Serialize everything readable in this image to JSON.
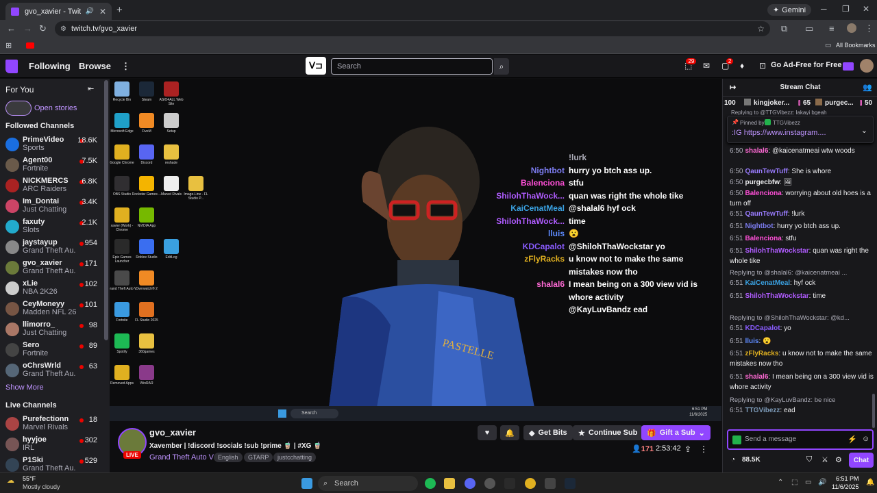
{
  "browser": {
    "tab_title": "gvo_xavier - Twitch",
    "new_tab": "+",
    "gemini_label": "Gemini",
    "url": "twitch.tv/gvo_xavier",
    "bookmarks_label": "All Bookmarks"
  },
  "twitch_nav": {
    "following": "Following",
    "browse": "Browse",
    "search_placeholder": "Search",
    "notif_count_1": "29",
    "notif_count_2": "2",
    "ad_free": "Go Ad-Free for Free"
  },
  "sidebar": {
    "for_you": "For You",
    "open_stories": "Open stories",
    "followed_header": "Followed Channels",
    "followed": [
      {
        "name": "PrimeVideo",
        "game": "Sports",
        "viewers": "18.6K",
        "color": "#1a6ee0"
      },
      {
        "name": "Agent00",
        "game": "Fortnite",
        "viewers": "7.5K",
        "color": "#6a5a4a"
      },
      {
        "name": "NICKMERCS",
        "game": "ARC Raiders",
        "viewers": "6.8K",
        "color": "#aa2222"
      },
      {
        "name": "Im_Dontai",
        "game": "Just Chatting",
        "viewers": "3.4K",
        "color": "#cc4466"
      },
      {
        "name": "faxuty",
        "game": "Slots",
        "viewers": "2.1K",
        "color": "#22aacc"
      },
      {
        "name": "jaystayup",
        "game": "Grand Theft Au...",
        "viewers": "954",
        "color": "#888888"
      },
      {
        "name": "gvo_xavier",
        "game": "Grand Theft Au...",
        "viewers": "171",
        "color": "#6b7a3a"
      },
      {
        "name": "xLie",
        "game": "NBA 2K26",
        "viewers": "102",
        "color": "#cccccc"
      },
      {
        "name": "CeyMoneyy",
        "game": "Madden NFL 26",
        "viewers": "101",
        "color": "#775544"
      },
      {
        "name": "llimorro_",
        "game": "Just Chatting",
        "viewers": "98",
        "color": "#aa7766"
      },
      {
        "name": "Sero",
        "game": "Fortnite",
        "viewers": "89",
        "color": "#444444"
      },
      {
        "name": "oChrsWrld",
        "game": "Grand Theft Au...",
        "viewers": "63",
        "color": "#556677"
      }
    ],
    "show_more": "Show More",
    "live_header": "Live Channels",
    "live": [
      {
        "name": "Purefectionn",
        "game": "Marvel Rivals",
        "viewers": "18",
        "color": "#aa4444"
      },
      {
        "name": "hyyjoe",
        "game": "IRL",
        "viewers": "302",
        "color": "#775555"
      },
      {
        "name": "P1Ski",
        "game": "Grand Theft Au...",
        "viewers": "529",
        "color": "#334455"
      }
    ]
  },
  "desktop_icons": [
    {
      "label": "Recycle Bin",
      "color": "#7fb0e0"
    },
    {
      "label": "Steam",
      "color": "#1b2838"
    },
    {
      "label": "ASIO4ALL Web Site",
      "color": "#aa2222"
    },
    {
      "label": "Microsoft Edge",
      "color": "#1fa0c8"
    },
    {
      "label": "FiveM",
      "color": "#f08a24"
    },
    {
      "label": "Setup",
      "color": "#cccccc"
    },
    {
      "label": "Google Chrome",
      "color": "#e0b020"
    },
    {
      "label": "Discord",
      "color": "#5865f2"
    },
    {
      "label": "reshade",
      "color": "#e8c040"
    },
    {
      "label": "OBS Studio",
      "color": "#302e31"
    },
    {
      "label": "Rockstar Games ...",
      "color": "#f4b400"
    },
    {
      "label": "Marvel Rivals",
      "color": "#eeeeee"
    },
    {
      "label": "Image-Line - FL Studio P...",
      "color": "#e8c040"
    },
    {
      "label": "xavier (Work) - Chrome",
      "color": "#e0b020"
    },
    {
      "label": "NVIDIA App",
      "color": "#76b900"
    },
    {
      "label": "Epic Games Launcher",
      "color": "#2a2a2a"
    },
    {
      "label": "Roblox Studio",
      "color": "#3a6ef0"
    },
    {
      "label": "EditLog",
      "color": "#3aa0e0"
    },
    {
      "label": "Grand Theft Auto V",
      "color": "#4a4a4a"
    },
    {
      "label": "Overwatch® 2",
      "color": "#f08a24"
    },
    {
      "label": "Fortnite",
      "color": "#3a9ae0"
    },
    {
      "label": "FL Studio 2025",
      "color": "#e07020"
    },
    {
      "label": "Spotify",
      "color": "#1db954"
    },
    {
      "label": "360games",
      "color": "#e8c040"
    },
    {
      "label": "Removed Apps",
      "color": "#e0b020"
    },
    {
      "label": "WinRAR",
      "color": "#8a3a8a"
    }
  ],
  "overlay_chat": [
    {
      "user": "",
      "msg": "!lurk",
      "color": "#adadb8"
    },
    {
      "user": "Nightbot",
      "msg": "hurry yo btch ass up.",
      "color": "#7c7cf0"
    },
    {
      "user": "Balenciona",
      "msg": "stfu",
      "color": "#ff4fd8"
    },
    {
      "user": "ShilohThaWock...",
      "msg": "quan was right the whole tike",
      "color": "#b05cff"
    },
    {
      "user": "KaiCenatMeal",
      "msg": "@shalal6 hyf ock",
      "color": "#3aa0e0"
    },
    {
      "user": "ShilohThaWock...",
      "msg": "time",
      "color": "#b05cff"
    },
    {
      "user": "lluis",
      "msg": "😮",
      "color": "#5e8bff"
    },
    {
      "user": "KDCapalot",
      "msg": "@ShilohThaWockstar yo",
      "color": "#8a5cff"
    },
    {
      "user": "zFlyRacks",
      "msg": "u know not to make the same",
      "color": "#e0b020"
    },
    {
      "user": "",
      "msg": "mistakes now tho",
      "color": "#ffffff"
    },
    {
      "user": "shalal6",
      "msg": "I mean being on a 300 view vid is",
      "color": "#ff6ad5"
    },
    {
      "user": "",
      "msg": "whore activity",
      "color": "#ffffff"
    },
    {
      "user": "",
      "msg": "@KayLuvBandz ead",
      "color": "#ffffff"
    }
  ],
  "vtaskbar_search": "Search",
  "vtaskbar_time": "6:51 PM",
  "vtaskbar_date": "11/6/2025",
  "stream": {
    "name": "gvo_xavier",
    "live": "LIVE",
    "title": "Xavember | !discord !socials !sub !prime 🧋 | #XG 🧋",
    "game": "Grand Theft Auto V",
    "tags": [
      "English",
      "GTARP",
      "justcchatting"
    ],
    "get_bits": "Get Bits",
    "continue_sub": "Continue Sub",
    "gift_sub": "Gift a Sub",
    "viewers": "171",
    "uptime": "2:53:42"
  },
  "chat": {
    "header": "Stream Chat",
    "leader_count": "100",
    "leader1": "kingjoker...",
    "leader1_val": "65",
    "leader2": "purgec...",
    "leader2_val": "50",
    "cut_reply": "Replying to @TTGVibezz: lakayi bgeah",
    "pinned_by": "Pinned by",
    "pinned_user": "TTGVibezz",
    "pinned_text": ":IG https://www.instagram....",
    "messages": [
      {
        "ts": "6:50",
        "user": "shalal6",
        "msg": ": @kaicenatmeai wtw woods",
        "color": "#ff6ad5",
        "reply": ""
      },
      {
        "ts": "6:50",
        "user": "QaunTewTuff",
        "msg": ": She is whore",
        "color": "#9a7cff",
        "reply": ""
      },
      {
        "ts": "6:50",
        "user": "purgecbfw",
        "msg": ": 🖼",
        "color": "#efeff1",
        "reply": ""
      },
      {
        "ts": "6:50",
        "user": "Balenciona",
        "msg": ": worrying about old hoes is a turn off",
        "color": "#ff4fd8",
        "reply": ""
      },
      {
        "ts": "6:51",
        "user": "QaunTewTuff",
        "msg": ": !lurk",
        "color": "#9a7cff",
        "reply": ""
      },
      {
        "ts": "6:51",
        "user": "Nightbot",
        "msg": ": hurry yo btch ass up.",
        "color": "#7c7cf0",
        "reply": ""
      },
      {
        "ts": "6:51",
        "user": "Balenciona",
        "msg": ": stfu",
        "color": "#ff4fd8",
        "reply": ""
      },
      {
        "ts": "6:51",
        "user": "ShilohThaWockstar",
        "msg": ": quan was right the whole tike",
        "color": "#b05cff",
        "reply": ""
      },
      {
        "ts": "6:51",
        "user": "KaiCenatMeal",
        "msg": ": hyf ock",
        "color": "#3aa0e0",
        "reply": "Replying to @shalal6: @kaicenatmeai ..."
      },
      {
        "ts": "6:51",
        "user": "ShilohThaWockstar",
        "msg": ": time",
        "color": "#b05cff",
        "reply": ""
      },
      {
        "ts": "6:51",
        "user": "KDCapalot",
        "msg": ": yo",
        "color": "#8a5cff",
        "reply": "Replying to @ShilohThaWockstar: @kd..."
      },
      {
        "ts": "6:51",
        "user": "lluis",
        "msg": ": 😮",
        "color": "#5e8bff",
        "reply": ""
      },
      {
        "ts": "6:51",
        "user": "zFlyRacks",
        "msg": ": u know not to make the same mistakes now tho",
        "color": "#e0b020",
        "reply": ""
      },
      {
        "ts": "6:51",
        "user": "shalal6",
        "msg": ": I mean being on a 300 view vid is whore activity",
        "color": "#ff6ad5",
        "reply": ""
      },
      {
        "ts": "6:51",
        "user": "TTGVibezz",
        "msg": ": ead",
        "color": "#7c9ab8",
        "reply": "Replying to @KayLuvBandz: be nice"
      }
    ],
    "input_placeholder": "Send a message",
    "points": "88.5K",
    "chat_button": "Chat"
  },
  "taskbar": {
    "weather_temp": "55°F",
    "weather_desc": "Mostly cloudy",
    "search": "Search",
    "time": "6:51 PM",
    "date": "11/6/2025"
  }
}
